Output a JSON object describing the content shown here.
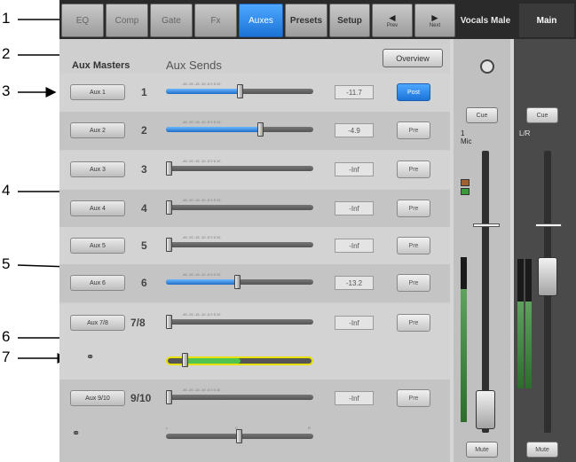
{
  "callouts": [
    "1",
    "2",
    "3",
    "4",
    "5",
    "6",
    "7"
  ],
  "tabs": [
    {
      "label": "EQ",
      "active": false
    },
    {
      "label": "Comp",
      "active": false
    },
    {
      "label": "Gate",
      "active": false
    },
    {
      "label": "Fx",
      "active": false
    },
    {
      "label": "Auxes",
      "active": true
    },
    {
      "label": "Presets",
      "active": false
    },
    {
      "label": "Setup",
      "active": false
    }
  ],
  "nav": {
    "prev_label": "Prev",
    "next_label": "Next"
  },
  "channel_names": {
    "vocals": "Vocals Male",
    "main": "Main"
  },
  "headers": {
    "aux_masters": "Aux Masters",
    "aux_sends": "Aux Sends"
  },
  "overview_label": "Overview",
  "rows": [
    {
      "button": "Aux 1",
      "num": "1",
      "value": "-11.7",
      "mode": "Post",
      "mode_on": true,
      "level": 0.5,
      "active": true
    },
    {
      "button": "Aux 2",
      "num": "2",
      "value": "-4.9",
      "mode": "Pre",
      "mode_on": false,
      "level": 0.64,
      "active": true
    },
    {
      "button": "Aux 3",
      "num": "3",
      "value": "-Inf",
      "mode": "Pre",
      "mode_on": false,
      "level": 0.0,
      "active": false
    },
    {
      "button": "Aux 4",
      "num": "4",
      "value": "-Inf",
      "mode": "Pre",
      "mode_on": false,
      "level": 0.0,
      "active": false
    },
    {
      "button": "Aux 5",
      "num": "5",
      "value": "-Inf",
      "mode": "Pre",
      "mode_on": false,
      "level": 0.0,
      "active": false
    },
    {
      "button": "Aux 6",
      "num": "6",
      "value": "-13.2",
      "mode": "Pre",
      "mode_on": false,
      "level": 0.48,
      "active": true
    },
    {
      "button": "Aux 7/8",
      "num": "7/8",
      "value": "-Inf",
      "mode": "Pre",
      "mode_on": false,
      "level": 0.0,
      "active": false
    },
    {
      "button": "Aux 9/10",
      "num": "9/10",
      "value": "-Inf",
      "mode": "Pre",
      "mode_on": false,
      "level": 0.0,
      "active": false
    }
  ],
  "scale_ticks": "-40   -20   -15   -10   -5    0    5   10",
  "pan_ticks": {
    "left": "L",
    "center": "C",
    "right": "R"
  },
  "strip": {
    "cue_label": "Cue",
    "mute_label": "Mute",
    "channel_line1": "1",
    "channel_line2": "Mic",
    "main_label": "L/R"
  },
  "colors": {
    "accent": "#1c73d8",
    "pan_fill": "#4fc24f",
    "pan_outline": "#e8e000"
  }
}
